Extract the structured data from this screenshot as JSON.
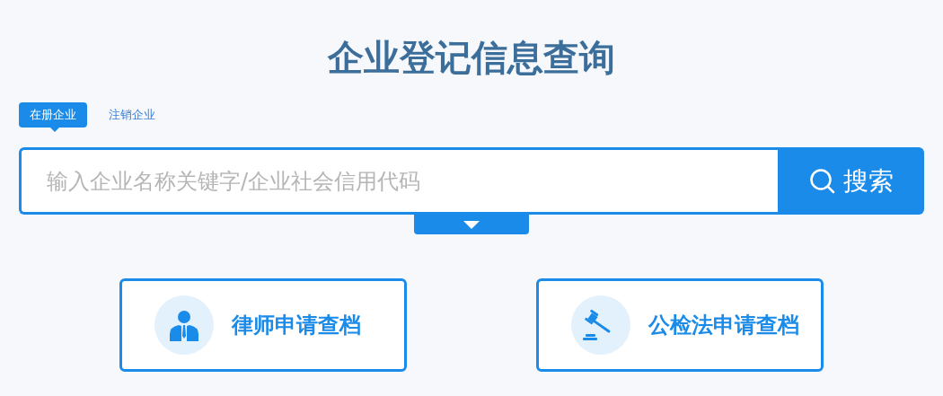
{
  "title": "企业登记信息查询",
  "tabs": [
    {
      "label": "在册企业",
      "selected": true
    },
    {
      "label": "注销企业",
      "selected": false
    }
  ],
  "search": {
    "placeholder": "输入企业名称关键字/企业社会信用代码",
    "button": "搜索"
  },
  "cards": [
    {
      "kind": "lawyer",
      "label": "律师申请查档"
    },
    {
      "kind": "gavel",
      "label": "公检法申请查档"
    }
  ]
}
